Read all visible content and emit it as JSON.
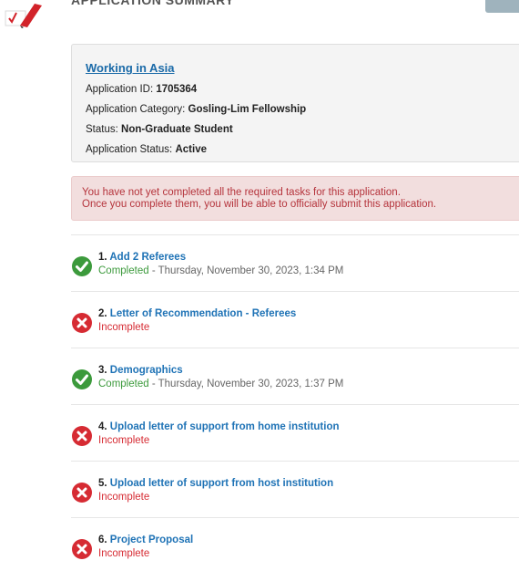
{
  "header": {
    "title": "APPLICATION SUMMARY"
  },
  "summary": {
    "program_link": "Working in Asia",
    "application_id_label": "Application ID:",
    "application_id": "1705364",
    "category_label": "Application Category:",
    "category": "Gosling-Lim Fellowship",
    "status_label": "Status:",
    "status": "Non-Graduate Student",
    "app_status_label": "Application Status:",
    "app_status": "Active"
  },
  "alert": {
    "line1": "You have not yet completed all the required tasks for this application.",
    "line2": "Once you complete them, you will be able to officially submit this application."
  },
  "tasks": [
    {
      "number": "1.",
      "title": "Add 2 Referees",
      "state": "Completed",
      "date": " - Thursday, November 30, 2023, 1:34 PM"
    },
    {
      "number": "2.",
      "title": "Letter of Recommendation - Referees",
      "state": "Incomplete",
      "date": ""
    },
    {
      "number": "3.",
      "title": "Demographics",
      "state": "Completed",
      "date": " - Thursday, November 30, 2023, 1:37 PM"
    },
    {
      "number": "4.",
      "title": "Upload letter of support from home institution",
      "state": "Incomplete",
      "date": ""
    },
    {
      "number": "5.",
      "title": "Upload letter of support from host institution",
      "state": "Incomplete",
      "date": ""
    },
    {
      "number": "6.",
      "title": "Project Proposal",
      "state": "Incomplete",
      "date": ""
    }
  ],
  "colors": {
    "completed": "#3c9a3c",
    "incomplete": "#d62b33",
    "link": "#1f73b6",
    "alert_bg": "#f2dede"
  },
  "icons": {
    "completed": "check-circle-icon",
    "incomplete": "x-circle-icon"
  }
}
